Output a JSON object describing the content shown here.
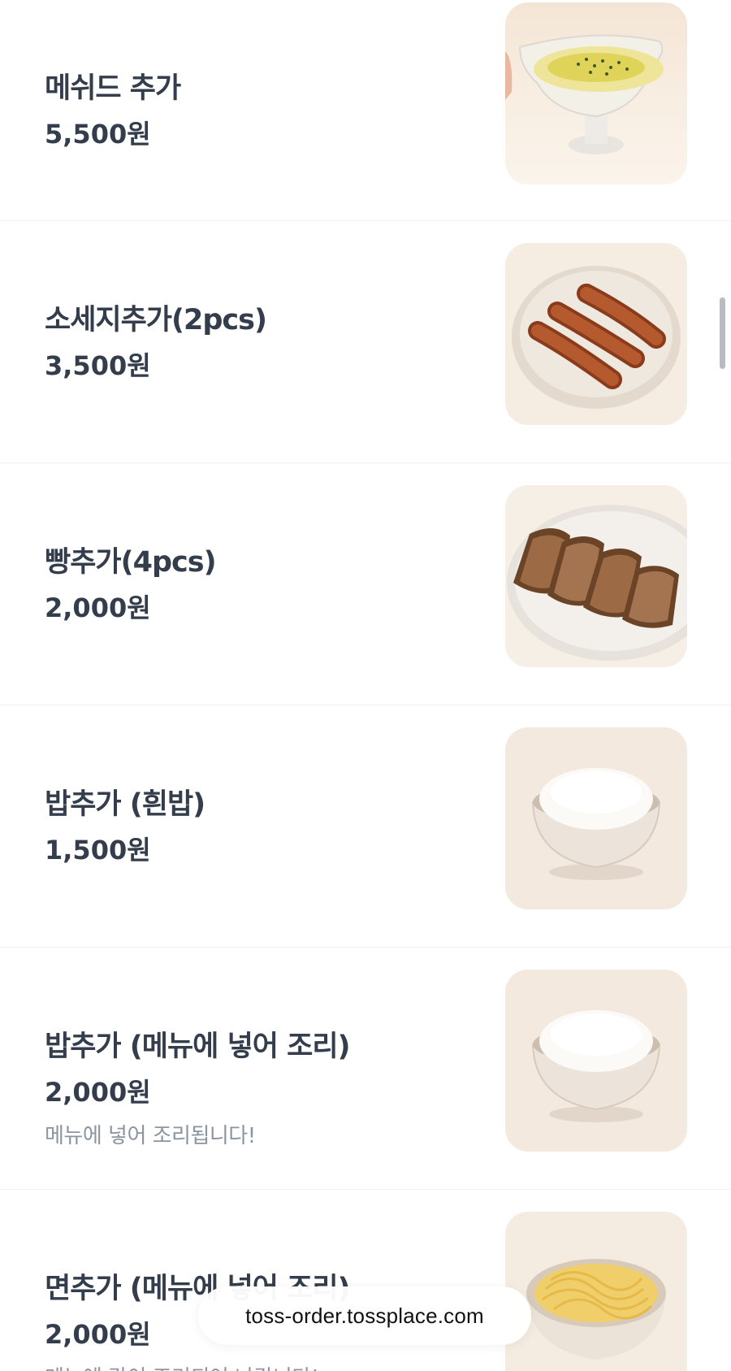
{
  "menu": {
    "items": [
      {
        "name": "메쉬드 추가",
        "price": "5,500원",
        "description": "",
        "image_icon": "mashed-potato-gravy-boat"
      },
      {
        "name": "소세지추가(2pcs)",
        "price": "3,500원",
        "description": "",
        "image_icon": "sausages-plate"
      },
      {
        "name": "빵추가(4pcs)",
        "price": "2,000원",
        "description": "",
        "image_icon": "bread-slices-plate"
      },
      {
        "name": "밥추가 (흰밥)",
        "price": "1,500원",
        "description": "",
        "image_icon": "rice-bowl"
      },
      {
        "name": "밥추가 (메뉴에 넣어 조리)",
        "price": "2,000원",
        "description": "메뉴에 넣어 조리됩니다!",
        "image_icon": "rice-bowl"
      },
      {
        "name": "면추가 (메뉴에 넣어 조리)",
        "price": "2,000원",
        "description": "메뉴에 같이 조리되어 나갑니다!",
        "image_icon": "noodle-bowl"
      }
    ]
  },
  "browser": {
    "url": "toss-order.tossplace.com"
  },
  "colors": {
    "text_primary": "#333d4b",
    "text_secondary": "#8b95a1",
    "divider": "#f0f1f3"
  }
}
